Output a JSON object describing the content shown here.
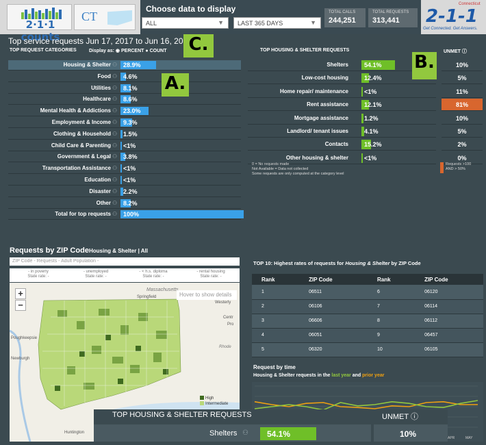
{
  "header": {
    "logo_text": "2·1·1 counts",
    "state_code": "CT",
    "choose_label": "Choose data to display",
    "category_select": "ALL",
    "period_select": "LAST 365 DAYS",
    "total_calls_label": "TOTAL CALLS",
    "total_calls": "244,251",
    "total_requests_label": "TOTAL REQUESTS",
    "total_requests": "313,441",
    "brand_state": "Connecticut",
    "brand_number": "2-1-1",
    "brand_tagline": "Get Connected. Get Answers."
  },
  "top_requests": {
    "title": "Top service requests Jun 17, 2017 to Jun 16, 2018",
    "categories_header": "TOP REQUEST CATEGORIES",
    "display_as": "Display as:",
    "option_percent": "PERCENT",
    "option_count": "COUNT",
    "rows": [
      {
        "label": "Housing & Shelter",
        "value": "28.9%",
        "pct": 28.9
      },
      {
        "label": "Food",
        "value": "4.6%",
        "pct": 4.6
      },
      {
        "label": "Utilities",
        "value": "8.1%",
        "pct": 8.1
      },
      {
        "label": "Healthcare",
        "value": "8.6%",
        "pct": 8.6
      },
      {
        "label": "Mental Health & Addictions",
        "value": "23.0%",
        "pct": 23.0
      },
      {
        "label": "Employment & Income",
        "value": "9.3%",
        "pct": 9.3
      },
      {
        "label": "Clothing & Household",
        "value": "1.5%",
        "pct": 1.5
      },
      {
        "label": "Child Care & Parenting",
        "value": "<1%",
        "pct": 0
      },
      {
        "label": "Government & Legal",
        "value": "3.8%",
        "pct": 3.8
      },
      {
        "label": "Transportation Assistance",
        "value": "<1%",
        "pct": 0
      },
      {
        "label": "Education",
        "value": "<1%",
        "pct": 0
      },
      {
        "label": "Disaster",
        "value": "2.2%",
        "pct": 2.2
      },
      {
        "label": "Other",
        "value": "8.2%",
        "pct": 8.2
      },
      {
        "label": "Total for top requests",
        "value": "100%",
        "pct": 100
      }
    ]
  },
  "housing": {
    "title": "TOP HOUSING & SHELTER REQUESTS",
    "unmet_title": "UNMET",
    "rows": [
      {
        "label": "Shelters",
        "value": "54.1%",
        "pct": 54.1,
        "unmet": "10%",
        "flag": false
      },
      {
        "label": "Low-cost housing",
        "value": "12.4%",
        "pct": 12.4,
        "unmet": "5%",
        "flag": false
      },
      {
        "label": "Home repair/ maintenance",
        "value": "<1%",
        "pct": 0,
        "unmet": "11%",
        "flag": false
      },
      {
        "label": "Rent assistance",
        "value": "12.1%",
        "pct": 12.1,
        "unmet": "81%",
        "flag": true
      },
      {
        "label": "Mortgage assistance",
        "value": "1.2%",
        "pct": 1.2,
        "unmet": "10%",
        "flag": false
      },
      {
        "label": "Landlord/ tenant issues",
        "value": "4.1%",
        "pct": 4.1,
        "unmet": "5%",
        "flag": false
      },
      {
        "label": "Contacts",
        "value": "15.2%",
        "pct": 15.2,
        "unmet": "2%",
        "flag": false
      },
      {
        "label": "Other housing & shelter",
        "value": "<1%",
        "pct": 0,
        "unmet": "0%",
        "flag": false
      }
    ],
    "note_line1": "0 = No requests made",
    "note_line2": "Not Available = Data not collected",
    "note_line3": "Some requests are only computed at the category level",
    "key_line1": "Requests >100",
    "key_line2": "AND > 50%"
  },
  "callouts": {
    "a": "A.",
    "b": "B.",
    "c": "C."
  },
  "zip": {
    "title": "Requests by ZIP Code",
    "subtitle": "Housing & Shelter | All",
    "filter_placeholder": "ZIP Code - Requests - Adult Population -",
    "stats": [
      {
        "line1": "- in poverty",
        "line2": "State rate: -"
      },
      {
        "line1": "- unemployed",
        "line2": "State rate: -"
      },
      {
        "line1": "- < h.s. diploma",
        "line2": "State rate: -"
      },
      {
        "line1": "- rental housing",
        "line2": "State rate: -"
      }
    ],
    "hover_tip": "Hover to show details",
    "zoom_in": "+",
    "zoom_out": "−",
    "places": [
      "Massachusetts",
      "Springfield",
      "Poughkeepsie",
      "Newburgh",
      "Huntington",
      "Westerly",
      "Centr",
      "Pro",
      "Rhode"
    ],
    "legend_high": "High",
    "legend_intermediate": "Intermediate"
  },
  "top10": {
    "title_prefix": "TOP 10: Highest rates of requests for",
    "title_category": "Housing & Shelter",
    "title_suffix": "by ZIP Code",
    "headers": [
      "Rank",
      "ZIP Code",
      "Rank",
      "ZIP Code"
    ],
    "rows": [
      [
        "1",
        "06511",
        "6",
        "06120"
      ],
      [
        "2",
        "06106",
        "7",
        "06114"
      ],
      [
        "3",
        "06606",
        "8",
        "06112"
      ],
      [
        "4",
        "06051",
        "9",
        "06457"
      ],
      [
        "5",
        "06320",
        "10",
        "06105"
      ]
    ]
  },
  "time": {
    "title": "Request by time",
    "subtitle_prefix": "Housing & Shelter requests in the",
    "last_year": "last year",
    "and": "and",
    "prior_year": "prior year",
    "month_labels": [
      "APR",
      "MAY"
    ],
    "last_year_series": [
      0.45,
      0.5,
      0.55,
      0.5,
      0.42,
      0.6,
      0.52,
      0.55,
      0.62,
      0.58,
      0.5,
      0.48,
      0.58,
      0.65
    ],
    "prior_year_series": [
      0.62,
      0.55,
      0.5,
      0.58,
      0.6,
      0.5,
      0.48,
      0.45,
      0.52,
      0.5,
      0.6,
      0.62,
      0.55,
      0.55
    ],
    "colors": {
      "last_year": "#92c83e",
      "prior_year": "#f0a010"
    }
  },
  "overlay": {
    "title": "TOP HOUSING & SHELTER REQUESTS",
    "unmet": "UNMET",
    "label": "Shelters",
    "value": "54.1%",
    "unmet_value": "10%"
  },
  "colors": {
    "bar_blue": "#3aa1e8",
    "bar_green": "#6fbf28",
    "flag": "#d8662e",
    "callout": "#92c83e"
  }
}
